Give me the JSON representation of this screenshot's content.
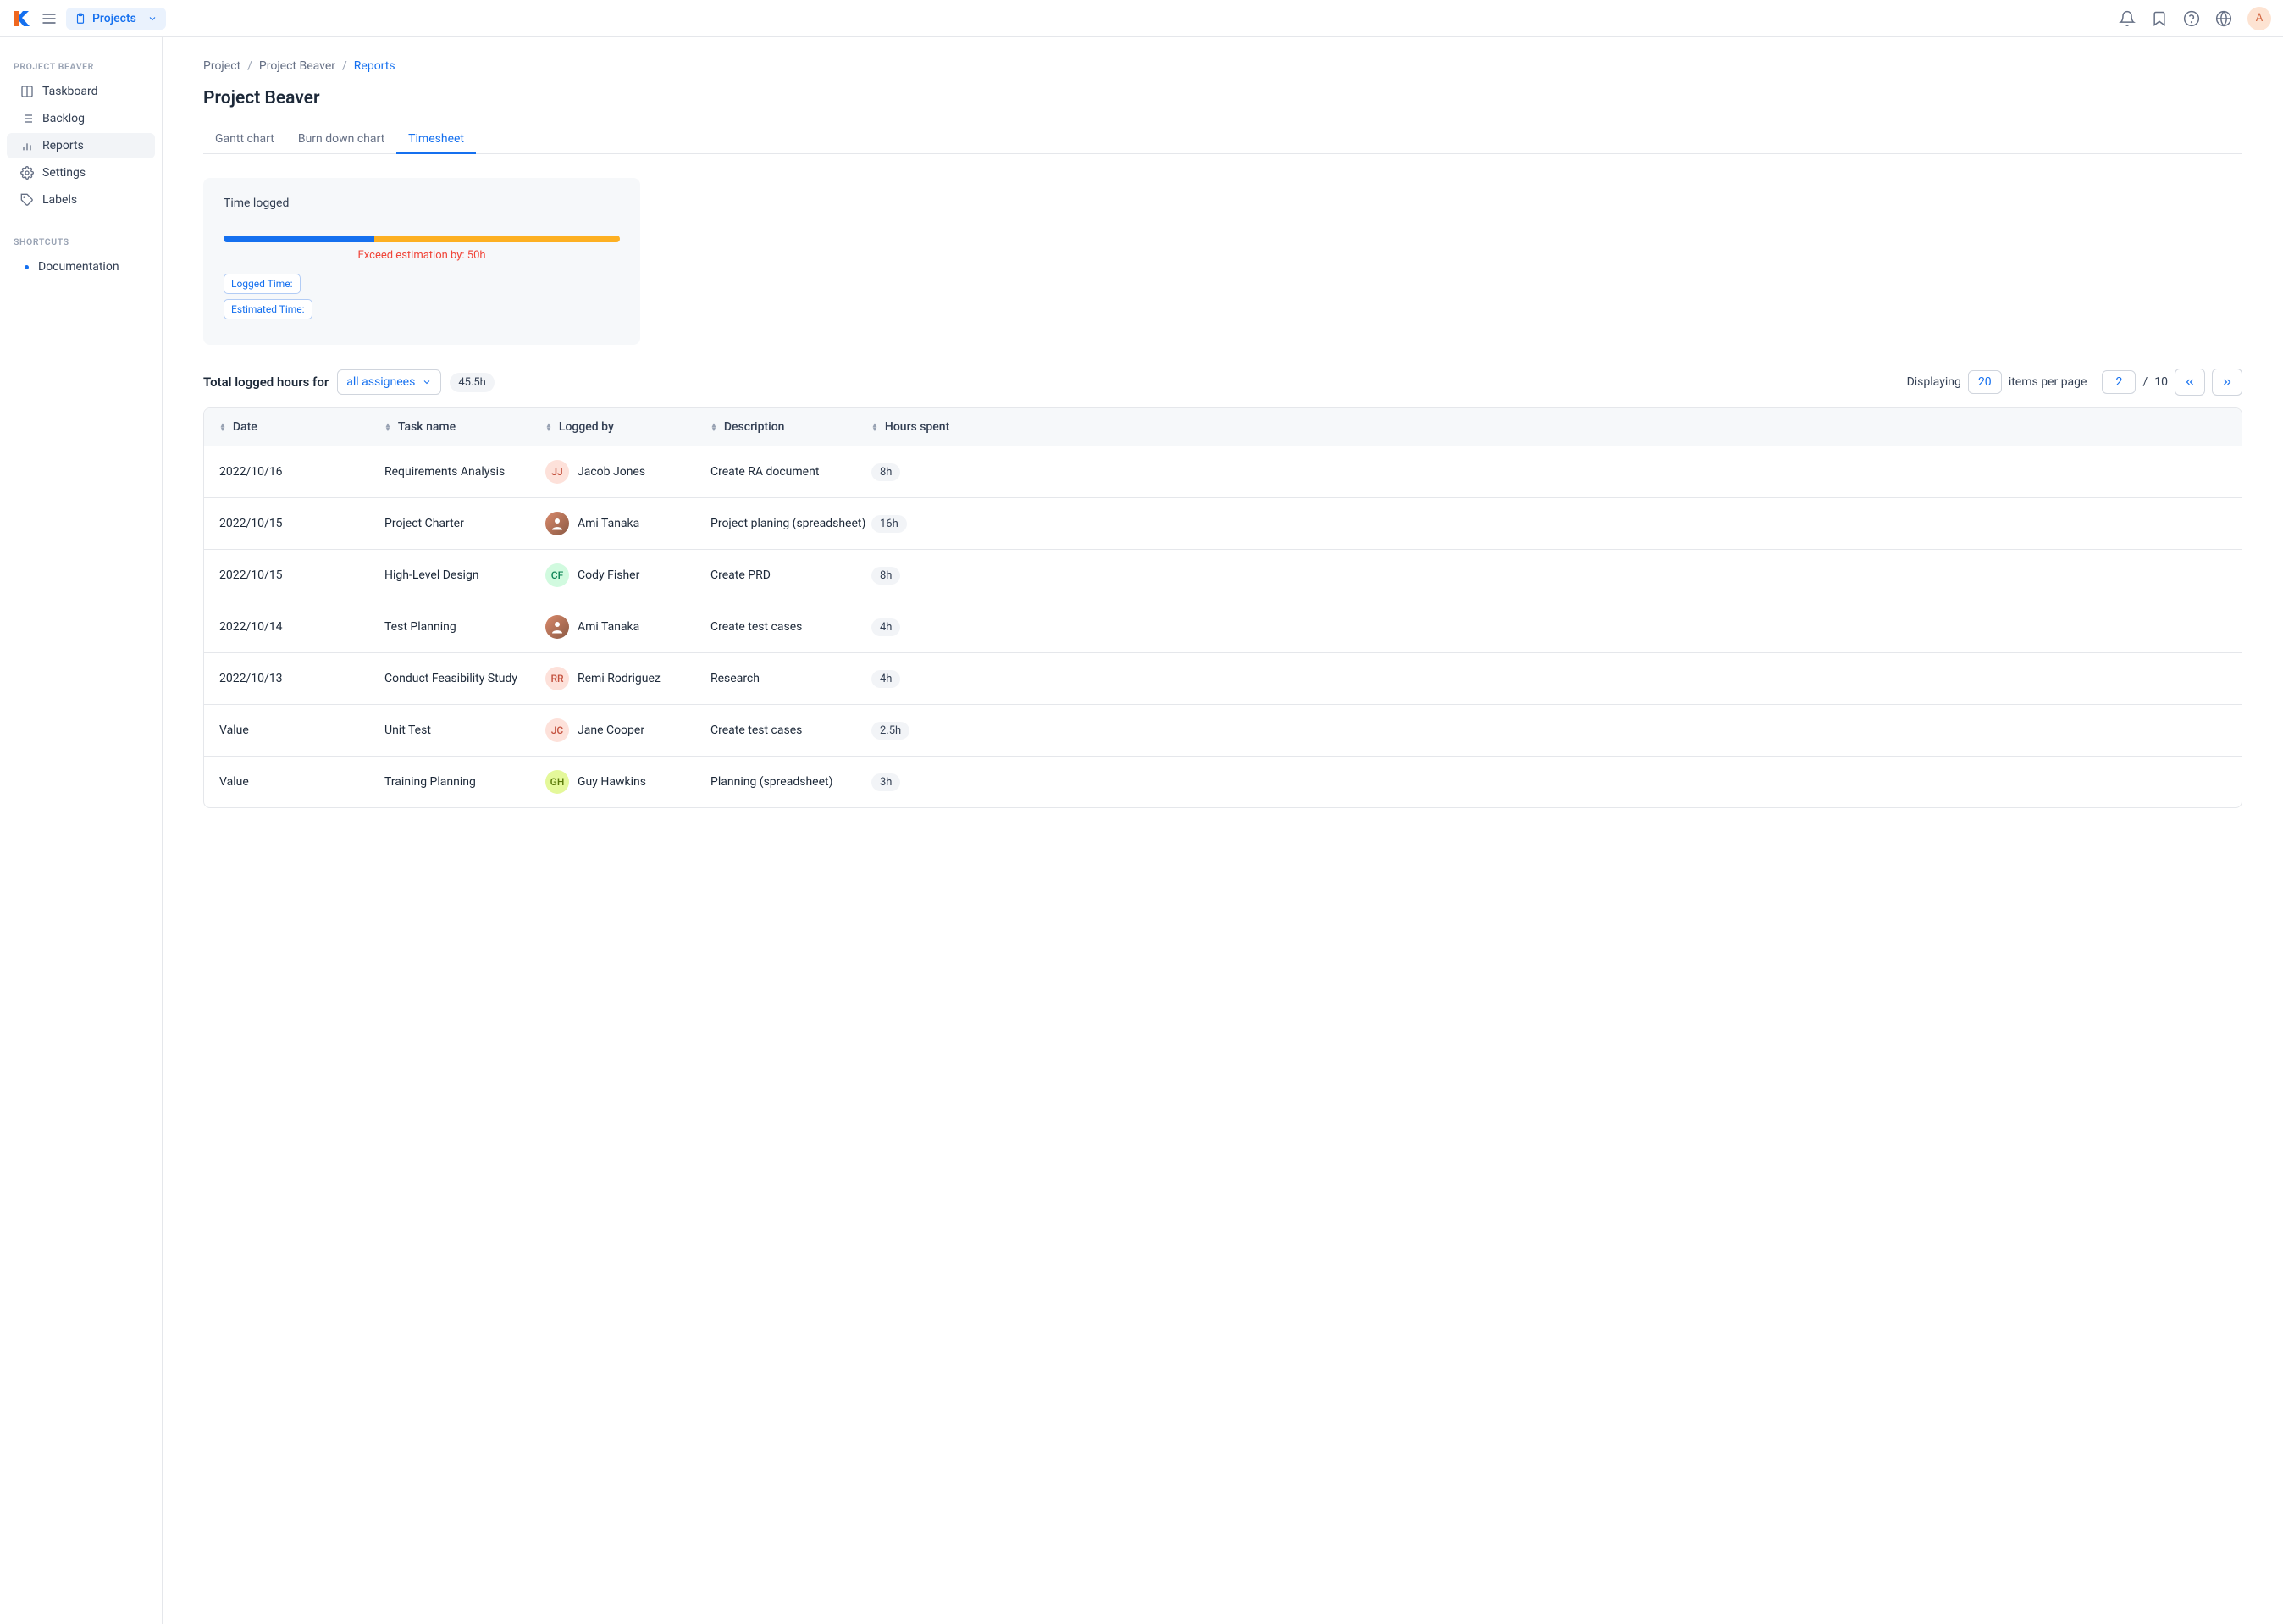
{
  "header": {
    "projects_label": "Projects",
    "avatar_letter": "A"
  },
  "sidebar": {
    "section1_title": "PROJECT BEAVER",
    "section2_title": "SHORTCUTS",
    "items": [
      {
        "label": "Taskboard"
      },
      {
        "label": "Backlog"
      },
      {
        "label": "Reports"
      },
      {
        "label": "Settings"
      },
      {
        "label": "Labels"
      }
    ],
    "shortcuts": [
      {
        "label": "Documentation"
      }
    ]
  },
  "breadcrumb": {
    "a": "Project",
    "b": "Project Beaver",
    "c": "Reports"
  },
  "page_title": "Project Beaver",
  "tabs": {
    "gantt": "Gantt chart",
    "burn": "Burn down chart",
    "timesheet": "Timesheet"
  },
  "card": {
    "title": "Time logged",
    "exceed": "Exceed estimation by: 50h",
    "logged_label": "Logged Time:",
    "est_label": "Estimated Time:"
  },
  "list": {
    "total_label": "Total logged hours for",
    "assignee_selected": "all assignees",
    "total_hours": "45.5h",
    "displaying": "Displaying",
    "items_per_page_value": "20",
    "items_per_page_label": "items per page",
    "page_current": "2",
    "page_total": "10"
  },
  "columns": {
    "date": "Date",
    "task": "Task name",
    "logged": "Logged by",
    "desc": "Description",
    "hours": "Hours spent"
  },
  "rows": [
    {
      "date": "2022/10/16",
      "task": "Requirements Analysis",
      "person": "Jacob Jones",
      "initials": "JJ",
      "av_bg": "#fde1da",
      "av_fg": "#c4523f",
      "photo": false,
      "desc": "Create RA document",
      "hours": "8h"
    },
    {
      "date": "2022/10/15",
      "task": "Project Charter",
      "person": "Ami Tanaka",
      "initials": "",
      "av_bg": "",
      "av_fg": "",
      "photo": true,
      "desc": "Project planing (spreadsheet)",
      "hours": "16h"
    },
    {
      "date": "2022/10/15",
      "task": "High-Level Design",
      "person": "Cody Fisher",
      "initials": "CF",
      "av_bg": "#d1fadf",
      "av_fg": "#12875a",
      "photo": false,
      "desc": "Create PRD",
      "hours": "8h"
    },
    {
      "date": "2022/10/14",
      "task": "Test Planning",
      "person": "Ami Tanaka",
      "initials": "",
      "av_bg": "",
      "av_fg": "",
      "photo": true,
      "desc": "Create test cases",
      "hours": "4h"
    },
    {
      "date": "2022/10/13",
      "task": "Conduct Feasibility Study",
      "person": "Remi Rodriguez",
      "initials": "RR",
      "av_bg": "#fde1da",
      "av_fg": "#c4523f",
      "photo": false,
      "desc": "Research",
      "hours": "4h"
    },
    {
      "date": "Value",
      "task": "Unit Test",
      "person": "Jane Cooper",
      "initials": "JC",
      "av_bg": "#fde1da",
      "av_fg": "#c4523f",
      "photo": false,
      "desc": "Create test cases",
      "hours": "2.5h"
    },
    {
      "date": "Value",
      "task": "Training Planning",
      "person": "Guy Hawkins",
      "initials": "GH",
      "av_bg": "#e4f89a",
      "av_fg": "#5a7a0a",
      "photo": false,
      "desc": "Planning (spreadsheet)",
      "hours": "3h"
    }
  ]
}
